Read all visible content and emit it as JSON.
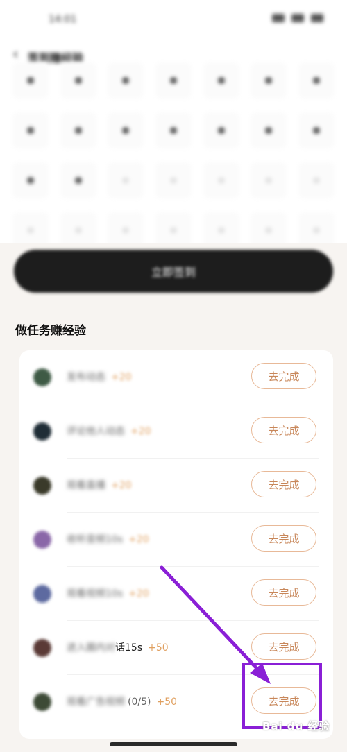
{
  "status": {
    "time": "14:01"
  },
  "nav": {
    "title": "签到赚经验"
  },
  "signin_button": "立即签到",
  "section_title": "做任务赚经验",
  "tasks": [
    {
      "name": "发布动态",
      "reward": "+20",
      "button": "去完成",
      "icon_color": "#3e5a45"
    },
    {
      "name": "评论他人动态",
      "reward": "+20",
      "button": "去完成",
      "icon_color": "#1f2d36"
    },
    {
      "name": "观看直播",
      "reward": "+20",
      "button": "去完成",
      "icon_color": "#3a3a2a"
    },
    {
      "name": "收听音频10s",
      "reward": "+20",
      "button": "去完成",
      "icon_color": "#8a67a8"
    },
    {
      "name": "观看视频10s",
      "reward": "+20",
      "button": "去完成",
      "icon_color": "#5d6aa0"
    },
    {
      "name_blur": "进入圈内对",
      "name_visible": "话15s",
      "reward": "+50",
      "button": "去完成",
      "icon_color": "#5a3a36"
    },
    {
      "name_blur": "观看广告视频",
      "name_visible": "(0/5)",
      "reward": "+50",
      "button": "去完成",
      "icon_color": "#3d4a36"
    }
  ],
  "watermark": "Bai du 经验",
  "colors": {
    "accent": "#c8875a",
    "annotation": "#8a1fd6"
  }
}
